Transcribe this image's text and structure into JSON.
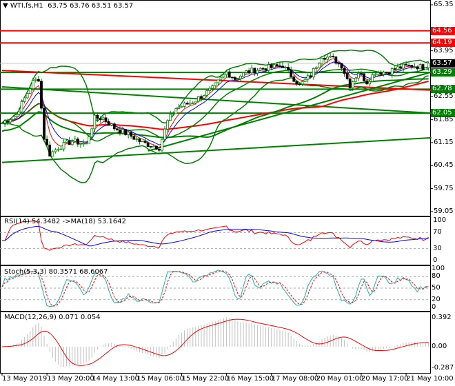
{
  "header": {
    "symbol": "WTI.fs,H1",
    "ohlc": "63.75 63.76 63.51 63.57"
  },
  "indicators": {
    "rsi": "RSI(14) 54.3482  ->MA(18) 53.1642",
    "stoch": "Stoch(5,3,3) 80.3571 68.6067",
    "macd": "MACD(12,26,9) 0.071 0.054"
  },
  "colors": {
    "up_line": "#008000",
    "down": "#ff0000",
    "green": "#008000",
    "bid": "#000000",
    "rsi": "#ff0000",
    "rsi_ma": "#0000ff",
    "stoch_main": "#20b2aa",
    "stoch_signal": "#ff0000",
    "macd_hist": "#c0c0c0"
  },
  "chart_data": {
    "type": "candlestick",
    "price_axis": {
      "ticks": [
        "65.35",
        "63.95",
        "62.55",
        "61.85",
        "61.15",
        "60.45",
        "59.75",
        "59.05"
      ],
      "range": [
        59.05,
        65.35
      ]
    },
    "levels": [
      {
        "price": 64.56,
        "label": "64.56",
        "color": "#ff0000"
      },
      {
        "price": 64.19,
        "label": "64.19",
        "color": "#ff0000"
      },
      {
        "price": 63.29,
        "label": "63.29",
        "color": "#008000"
      },
      {
        "price": 62.78,
        "label": "62.78",
        "color": "#008000"
      },
      {
        "price": 62.05,
        "label": "62.05",
        "color": "#008000"
      }
    ],
    "current_price": {
      "price": 63.57,
      "label": "63.57"
    },
    "trendlines": [
      {
        "from": [
          0,
          63.35
        ],
        "to": [
          153,
          62.75
        ],
        "color": "#ff0000"
      },
      {
        "from": [
          0,
          60.55
        ],
        "to": [
          153,
          61.3
        ],
        "color": "#008000"
      },
      {
        "from": [
          52,
          60.9
        ],
        "to": [
          153,
          63.3
        ],
        "color": "#008000"
      },
      {
        "from": [
          0,
          62.85
        ],
        "to": [
          153,
          62.05
        ],
        "color": "#008000"
      }
    ],
    "close_keypoints": [
      [
        0,
        61.75
      ],
      [
        5,
        62.0
      ],
      [
        8,
        62.5
      ],
      [
        11,
        63.0
      ],
      [
        13,
        63.1
      ],
      [
        15,
        61.3
      ],
      [
        17,
        60.8
      ],
      [
        20,
        61.0
      ],
      [
        25,
        61.2
      ],
      [
        30,
        61.1
      ],
      [
        33,
        61.9
      ],
      [
        36,
        61.9
      ],
      [
        40,
        61.6
      ],
      [
        45,
        61.4
      ],
      [
        50,
        61.15
      ],
      [
        56,
        61.0
      ],
      [
        59,
        61.8
      ],
      [
        62,
        62.2
      ],
      [
        68,
        62.4
      ],
      [
        75,
        62.8
      ],
      [
        80,
        63.3
      ],
      [
        83,
        63.1
      ],
      [
        87,
        63.3
      ],
      [
        92,
        63.4
      ],
      [
        100,
        63.5
      ],
      [
        103,
        63.2
      ],
      [
        106,
        62.9
      ],
      [
        110,
        63.2
      ],
      [
        114,
        63.8
      ],
      [
        118,
        63.7
      ],
      [
        121,
        63.5
      ],
      [
        124,
        62.9
      ],
      [
        127,
        63.3
      ],
      [
        130,
        63.0
      ],
      [
        133,
        63.3
      ],
      [
        137,
        63.3
      ],
      [
        142,
        63.45
      ],
      [
        146,
        63.5
      ],
      [
        150,
        63.45
      ],
      [
        152,
        63.57
      ]
    ],
    "bars": 153,
    "rsi_axis": [
      "100",
      "70",
      "30",
      "0"
    ],
    "stoch_axis": [
      "100",
      "80",
      "50",
      "20",
      "0"
    ],
    "macd_axis": [
      "0.392",
      "0.00",
      "-0.287"
    ],
    "time_axis": [
      "13 May 2019",
      "13 May 20:00",
      "14 May 13:00",
      "15 May 06:00",
      "15 May 22:00",
      "16 May 15:00",
      "17 May 08:00",
      "20 May 01:00",
      "20 May 17:00",
      "21 May 10:00"
    ]
  }
}
